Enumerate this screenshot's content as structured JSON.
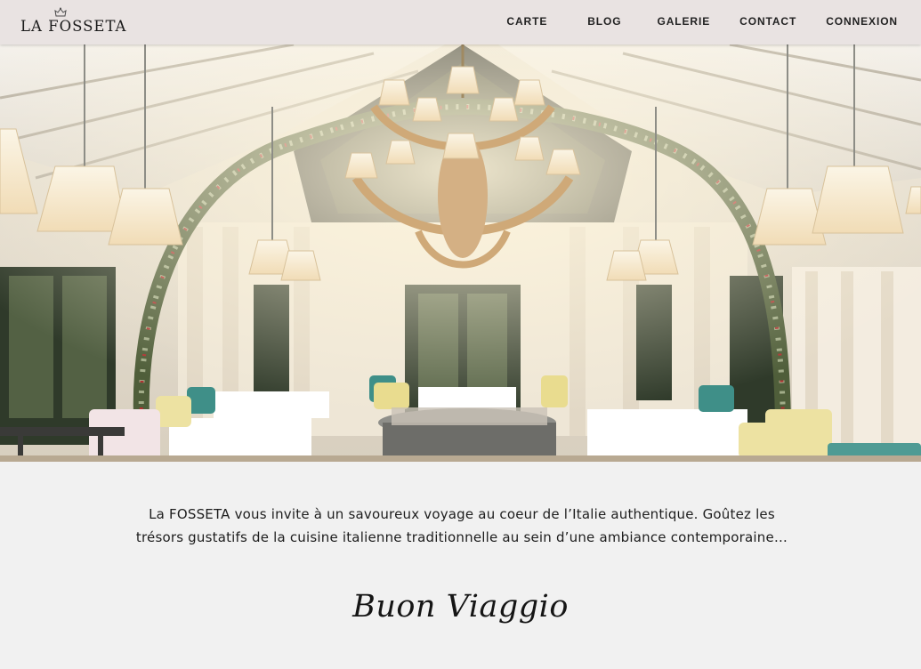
{
  "header": {
    "brand": "LA FOSSETA",
    "logo_icon": "crest-icon"
  },
  "nav": {
    "items": [
      {
        "label": "CARTE"
      },
      {
        "label": "BLOG"
      },
      {
        "label": "GALERIE"
      },
      {
        "label": "CONTACT"
      },
      {
        "label": "CONNEXION"
      }
    ]
  },
  "hero": {
    "icon": "restaurant-interior-photo"
  },
  "intro": {
    "text": "La FOSSETA vous invite à un savoureux voyage au coeur de l’Italie authentique. Goûtez les trésors gustatifs de la cuisine italienne traditionnelle au sein d’une ambiance contemporaine…"
  },
  "signoff": {
    "text": "Buon Viaggio"
  },
  "colors": {
    "header_bg": "#e9e3e2",
    "page_bg": "#f1f1f1",
    "text": "#1c1c1c"
  }
}
